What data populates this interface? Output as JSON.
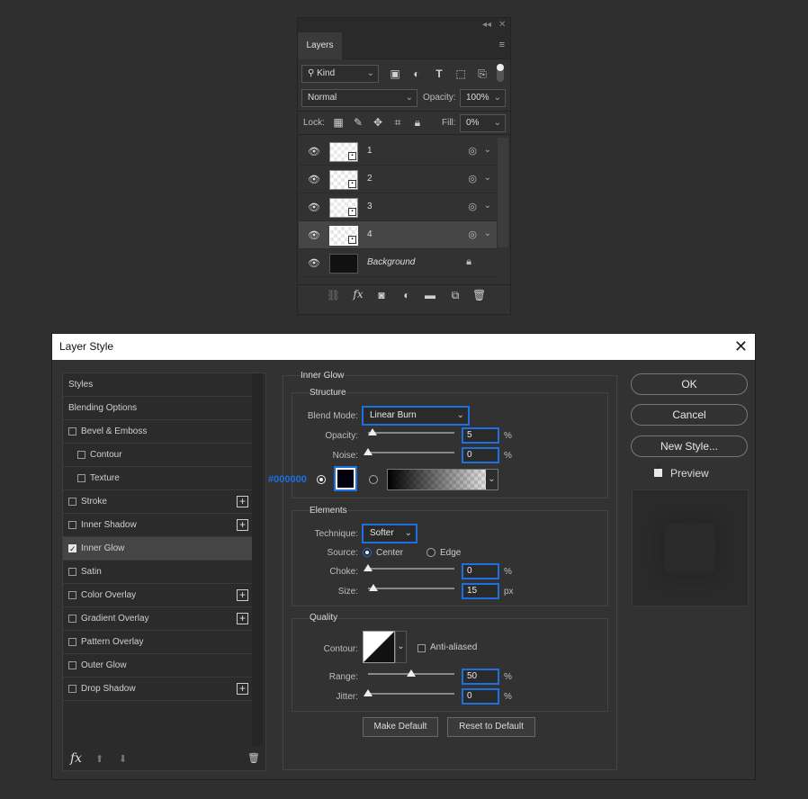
{
  "layers_panel": {
    "tab": "Layers",
    "kind": "Kind",
    "blend": "Normal",
    "opacity_label": "Opacity:",
    "opacity": "100%",
    "lock_label": "Lock:",
    "fill_label": "Fill:",
    "fill": "0%",
    "layers": [
      {
        "name": "1"
      },
      {
        "name": "2"
      },
      {
        "name": "3"
      },
      {
        "name": "4"
      },
      {
        "name": "Background"
      }
    ]
  },
  "dialog": {
    "title": "Layer Style",
    "styles_list": [
      {
        "label": "Styles"
      },
      {
        "label": "Blending Options"
      },
      {
        "label": "Bevel & Emboss"
      },
      {
        "label": "Contour"
      },
      {
        "label": "Texture"
      },
      {
        "label": "Stroke"
      },
      {
        "label": "Inner Shadow"
      },
      {
        "label": "Inner Glow"
      },
      {
        "label": "Satin"
      },
      {
        "label": "Color Overlay"
      },
      {
        "label": "Gradient Overlay"
      },
      {
        "label": "Pattern Overlay"
      },
      {
        "label": "Outer Glow"
      },
      {
        "label": "Drop Shadow"
      }
    ],
    "section_title": "Inner Glow",
    "structure": {
      "title": "Structure",
      "blend_mode_label": "Blend Mode:",
      "blend_mode": "Linear Burn",
      "opacity_label": "Opacity:",
      "opacity": "5",
      "noise_label": "Noise:",
      "noise": "0",
      "percent": "%",
      "color_hex": "#000000"
    },
    "elements": {
      "title": "Elements",
      "technique_label": "Technique:",
      "technique": "Softer",
      "source_label": "Source:",
      "source_center": "Center",
      "source_edge": "Edge",
      "choke_label": "Choke:",
      "choke": "0",
      "size_label": "Size:",
      "size": "15",
      "px": "px"
    },
    "quality": {
      "title": "Quality",
      "contour_label": "Contour:",
      "anti_aliased": "Anti-aliased",
      "range_label": "Range:",
      "range": "50",
      "jitter_label": "Jitter:",
      "jitter": "0"
    },
    "make_default": "Make Default",
    "reset_default": "Reset to Default",
    "ok": "OK",
    "cancel": "Cancel",
    "new_style": "New Style...",
    "preview": "Preview",
    "fx": "fx"
  }
}
